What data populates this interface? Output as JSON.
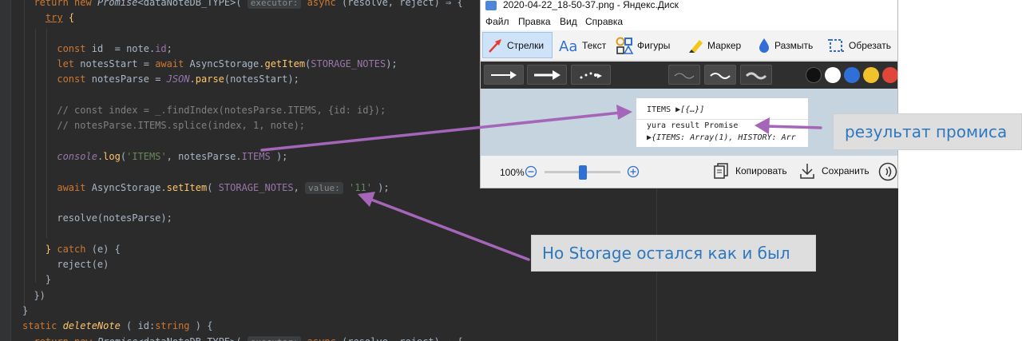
{
  "editor": {
    "lines": [
      [
        {
          "t": "  "
        },
        {
          "t": "return ",
          "c": "kw"
        },
        {
          "t": "new ",
          "c": "kw"
        },
        {
          "t": "Promise",
          "c": "ty"
        },
        {
          "t": "<dataNoteDB_TYPE>( "
        },
        {
          "t": "executor:",
          "c": "hint"
        },
        {
          "t": " "
        },
        {
          "t": "async",
          "c": "kw"
        },
        {
          "t": " (resolve, reject) ⇒ {"
        }
      ],
      [
        {
          "t": "    "
        },
        {
          "t": "try",
          "c": "ykw"
        },
        {
          "t": " "
        },
        {
          "t": "{",
          "c": "fn"
        }
      ],
      [
        {
          "t": ""
        }
      ],
      [
        {
          "t": "      "
        },
        {
          "t": "const ",
          "c": "kw"
        },
        {
          "t": "id  = note."
        },
        {
          "t": "id",
          "c": "prop"
        },
        {
          "t": ";"
        }
      ],
      [
        {
          "t": "      "
        },
        {
          "t": "let ",
          "c": "kw"
        },
        {
          "t": "notesStart = "
        },
        {
          "t": "await ",
          "c": "kw"
        },
        {
          "t": "AsyncStorage."
        },
        {
          "t": "getItem",
          "c": "fn"
        },
        {
          "t": "("
        },
        {
          "t": "STORAGE_NOTES",
          "c": "prop"
        },
        {
          "t": ");"
        }
      ],
      [
        {
          "t": "      "
        },
        {
          "t": "const ",
          "c": "kw"
        },
        {
          "t": "notesParse = "
        },
        {
          "t": "JSON",
          "c": "it"
        },
        {
          "t": "."
        },
        {
          "t": "parse",
          "c": "fn"
        },
        {
          "t": "(notesStart);"
        }
      ],
      [
        {
          "t": ""
        }
      ],
      [
        {
          "t": "      "
        },
        {
          "t": "// const index = _.findIndex(notesParse.ITEMS, {id: id});",
          "c": "cm"
        }
      ],
      [
        {
          "t": "      "
        },
        {
          "t": "// notesParse.ITEMS.splice(index, 1, note);",
          "c": "cm"
        }
      ],
      [
        {
          "t": ""
        }
      ],
      [
        {
          "t": "      "
        },
        {
          "t": "console",
          "c": "it"
        },
        {
          "t": "."
        },
        {
          "t": "log",
          "c": "fn"
        },
        {
          "t": "("
        },
        {
          "t": "'ITEMS'",
          "c": "str"
        },
        {
          "t": ", notesParse."
        },
        {
          "t": "ITEMS",
          "c": "prop"
        },
        {
          "t": " );"
        }
      ],
      [
        {
          "t": ""
        }
      ],
      [
        {
          "t": "      "
        },
        {
          "t": "await ",
          "c": "kw"
        },
        {
          "t": "AsyncStorage."
        },
        {
          "t": "setItem",
          "c": "fn"
        },
        {
          "t": "( "
        },
        {
          "t": "STORAGE_NOTES",
          "c": "prop"
        },
        {
          "t": ", "
        },
        {
          "t": "value:",
          "c": "hint"
        },
        {
          "t": " "
        },
        {
          "t": "'11'",
          "c": "str"
        },
        {
          "t": " );"
        }
      ],
      [
        {
          "t": ""
        }
      ],
      [
        {
          "t": "      resolve(notesParse);"
        }
      ],
      [
        {
          "t": ""
        }
      ],
      [
        {
          "t": "    "
        },
        {
          "t": "}",
          "c": "fn"
        },
        {
          "t": " "
        },
        {
          "t": "catch",
          "c": "kw"
        },
        {
          "t": " (e) {"
        }
      ],
      [
        {
          "t": "      reject(e)"
        }
      ],
      [
        {
          "t": "    }"
        }
      ],
      [
        {
          "t": "  })"
        }
      ],
      [
        {
          "t": "}"
        }
      ],
      [
        {
          "t": "static ",
          "c": "kw"
        },
        {
          "t": "deleteNote",
          "c": "fnit"
        },
        {
          "t": " ( id:"
        },
        {
          "t": "string",
          "c": "kw"
        },
        {
          "t": " ) {"
        }
      ],
      [
        {
          "t": "  "
        },
        {
          "t": "return ",
          "c": "kw"
        },
        {
          "t": "new ",
          "c": "kw"
        },
        {
          "t": "Promise",
          "c": "ty"
        },
        {
          "t": "<dataNoteDB_TYPE>( "
        },
        {
          "t": "executor:",
          "c": "hint"
        },
        {
          "t": " "
        },
        {
          "t": "async",
          "c": "kw"
        },
        {
          "t": " (resolve, reject) ⇒ {"
        }
      ]
    ]
  },
  "viewer": {
    "title": "2020-04-22_18-50-37.png - Яндекс.Диск",
    "menu": [
      "Файл",
      "Правка",
      "Вид",
      "Справка"
    ],
    "tools": [
      {
        "label": "Стрелки",
        "icon": "arrow-tool-icon",
        "active": true
      },
      {
        "label": "Текст",
        "icon": "text-tool-icon",
        "active": false
      },
      {
        "label": "Фигуры",
        "icon": "shapes-tool-icon",
        "active": false
      },
      {
        "label": "Маркер",
        "icon": "marker-tool-icon",
        "active": false
      },
      {
        "label": "Размыть",
        "icon": "blur-tool-icon",
        "active": false
      },
      {
        "label": "Обрезать",
        "icon": "crop-tool-icon",
        "active": false
      }
    ],
    "palette": [
      "#111111",
      "#ffffff",
      "#2f6fd6",
      "#f2c12e",
      "#e0463a"
    ],
    "console": {
      "row1_key": "ITEMS",
      "row1_value": "[{…}]",
      "row2": "yura result Promise",
      "row3": "{ITEMS: Array(1), HISTORY: Arr"
    },
    "zoom": "100%",
    "zoom_level": 0.5,
    "copy_label": "Копировать",
    "save_label": "Сохранить"
  },
  "annotations": {
    "promise_result": "результат промиса",
    "storage_unchanged": "Но Storage остался как и был"
  }
}
